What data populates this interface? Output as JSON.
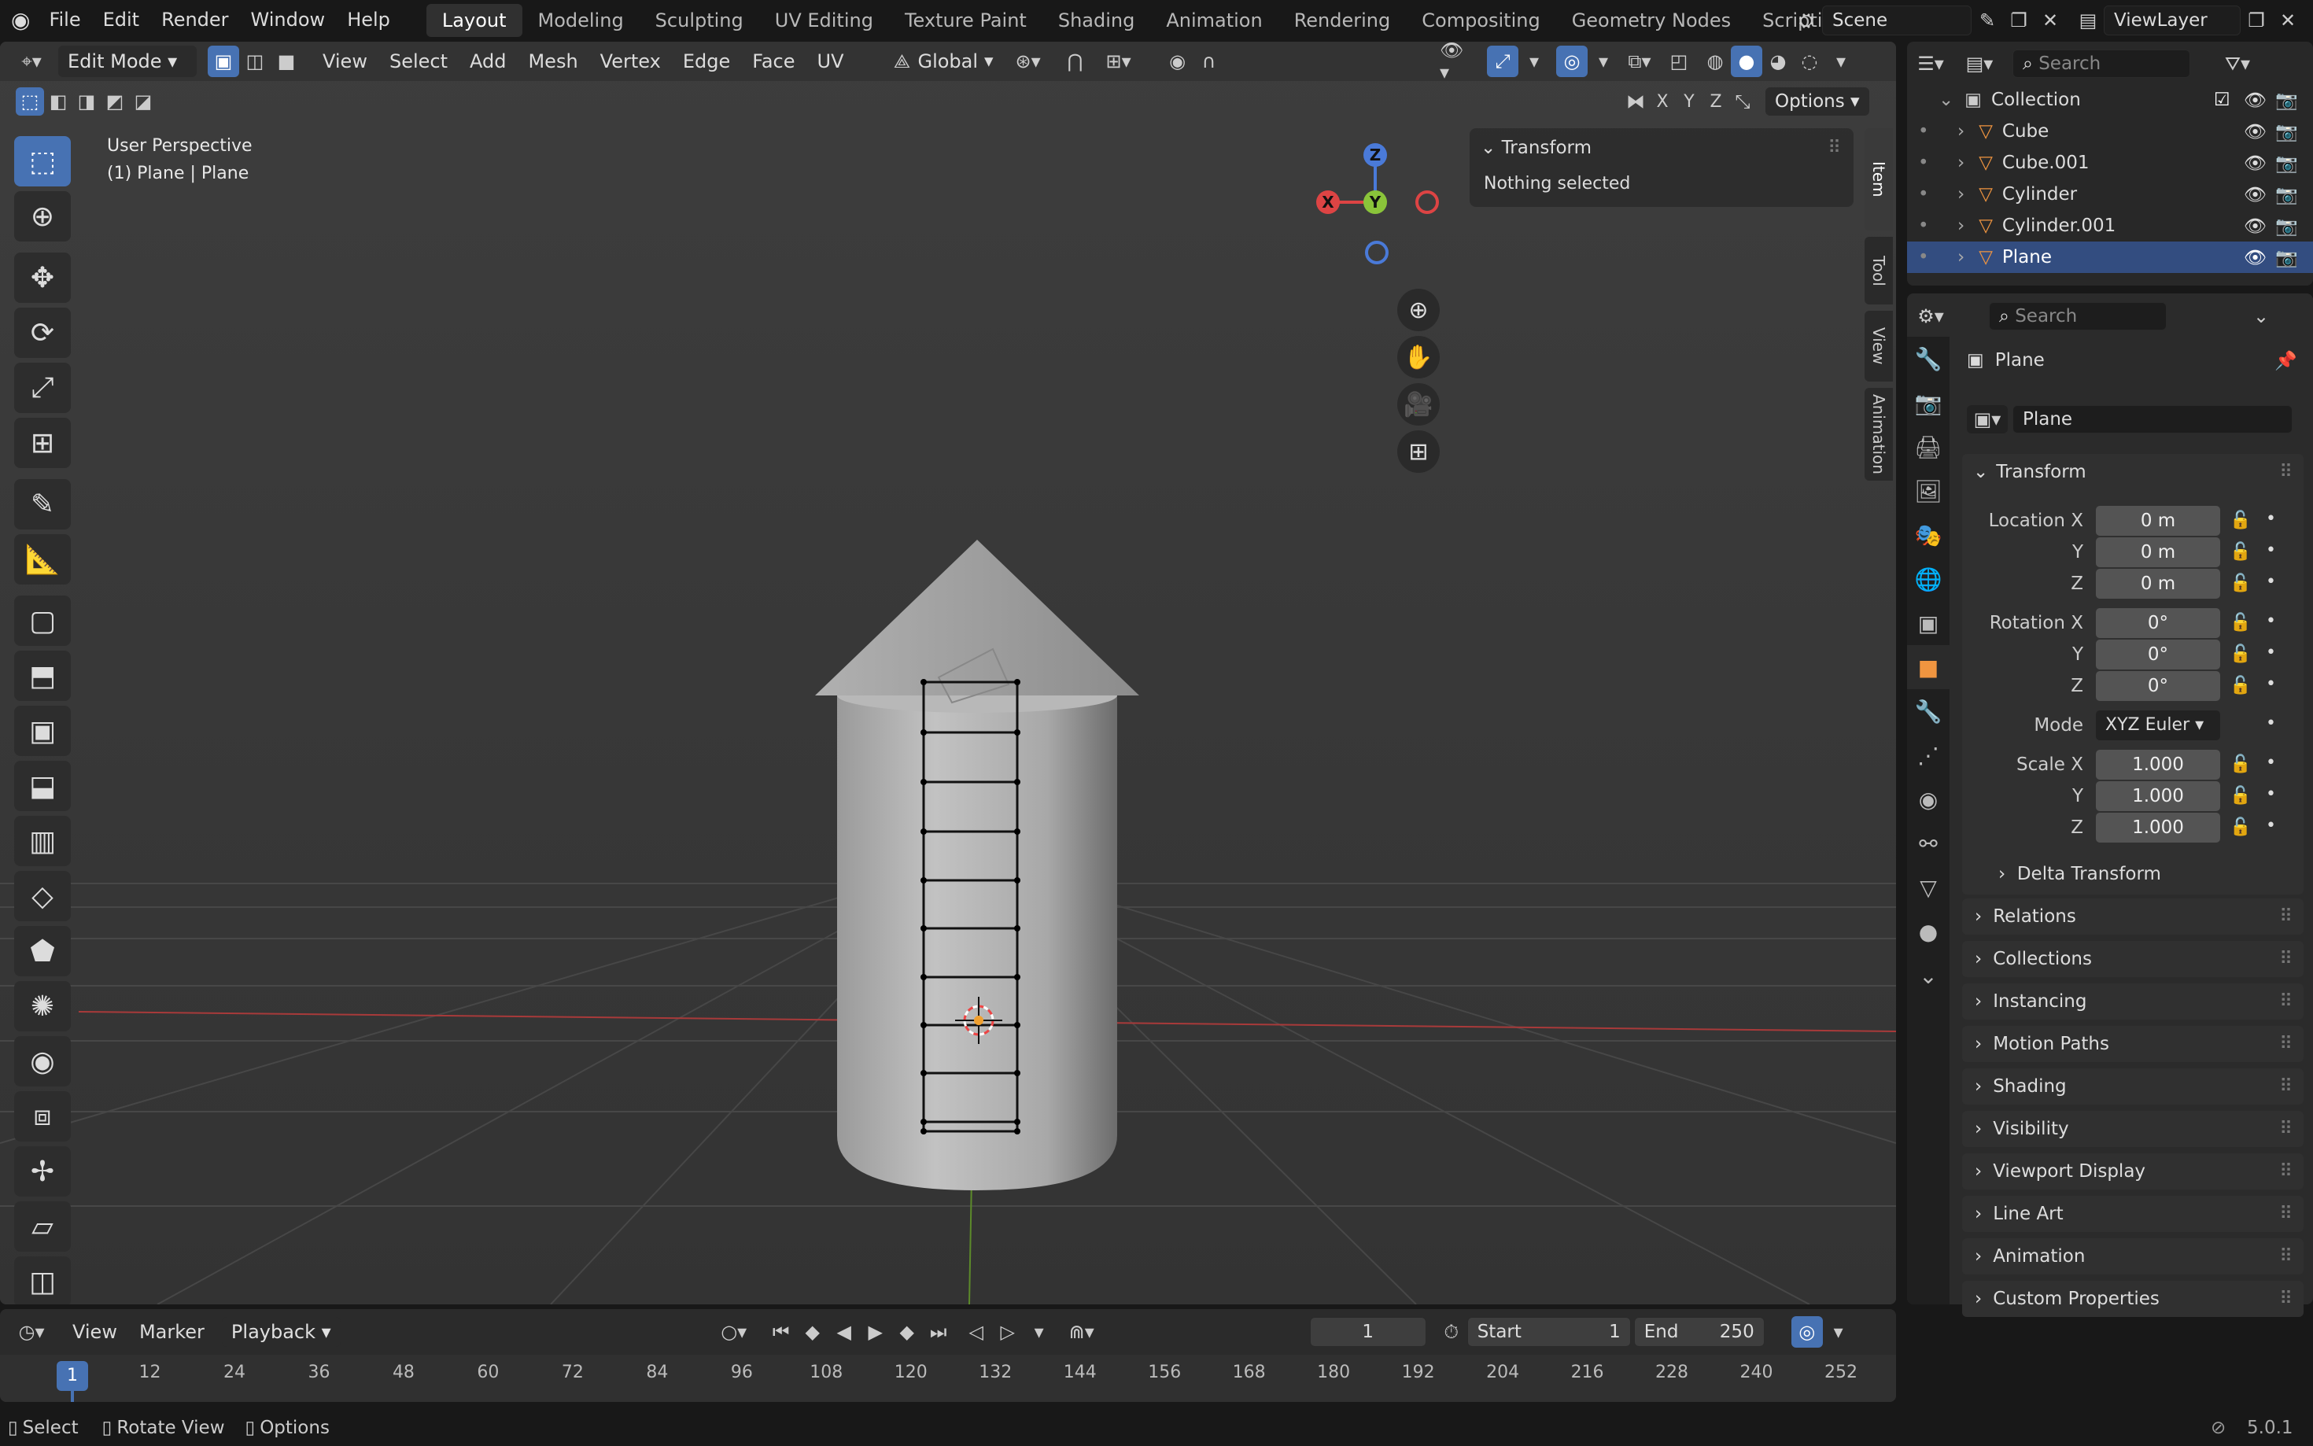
{
  "topbar": {
    "menus": [
      "File",
      "Edit",
      "Render",
      "Window",
      "Help"
    ],
    "workspaces": [
      "Layout",
      "Modeling",
      "Sculpting",
      "UV Editing",
      "Texture Paint",
      "Shading",
      "Animation",
      "Rendering",
      "Compositing",
      "Geometry Nodes",
      "Scripting"
    ],
    "active_workspace": "Layout",
    "scene": "Scene",
    "view_layer": "ViewLayer"
  },
  "viewport_header": {
    "mode": "Edit Mode",
    "menus": [
      "View",
      "Select",
      "Add",
      "Mesh",
      "Vertex",
      "Edge",
      "Face",
      "UV"
    ],
    "orientation": "Global",
    "axes": [
      "X",
      "Y",
      "Z"
    ],
    "options": "Options"
  },
  "viewport": {
    "perspective": "User Perspective",
    "object_info": "(1) Plane | Plane",
    "transform_title": "Transform",
    "nothing_selected": "Nothing selected",
    "tabs": [
      "Item",
      "Tool",
      "View",
      "Animation"
    ],
    "gizmo": {
      "x": "X",
      "y": "Y",
      "z": "Z"
    }
  },
  "outliner": {
    "search_placeholder": "Search",
    "collection": "Collection",
    "items": [
      "Cube",
      "Cube.001",
      "Cylinder",
      "Cylinder.001",
      "Plane"
    ],
    "selected": "Plane"
  },
  "properties": {
    "search_placeholder": "Search",
    "object_name": "Plane",
    "object_field": "Plane",
    "transform": "Transform",
    "location_label": "Location X",
    "rotation_label": "Rotation X",
    "scale_label": "Scale X",
    "y": "Y",
    "z": "Z",
    "location": [
      "0 m",
      "0 m",
      "0 m"
    ],
    "rotation": [
      "0°",
      "0°",
      "0°"
    ],
    "mode_label": "Mode",
    "mode": "XYZ Euler",
    "scale": [
      "1.000",
      "1.000",
      "1.000"
    ],
    "delta": "Delta Transform",
    "panels": [
      "Relations",
      "Collections",
      "Instancing",
      "Motion Paths",
      "Shading",
      "Visibility",
      "Viewport Display",
      "Line Art",
      "Animation",
      "Custom Properties"
    ]
  },
  "timeline": {
    "menus": [
      "View",
      "Marker",
      "Playback"
    ],
    "current_frame": "1",
    "start_label": "Start",
    "start": "1",
    "end_label": "End",
    "end": "250",
    "ticks": [
      "1",
      "12",
      "24",
      "36",
      "48",
      "60",
      "72",
      "84",
      "96",
      "108",
      "120",
      "132",
      "144",
      "156",
      "168",
      "180",
      "192",
      "204",
      "216",
      "228",
      "240",
      "252"
    ]
  },
  "status": {
    "select": "Select",
    "rotate": "Rotate View",
    "options": "Options",
    "version": "5.0.1"
  },
  "colors": {
    "accent": "#4772b3",
    "selected_row": "#334d80",
    "object_orange": "#f09540"
  }
}
